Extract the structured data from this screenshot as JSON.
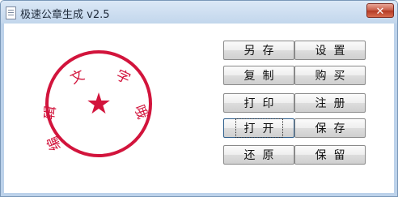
{
  "window": {
    "title": "极速公章生成 v2.5",
    "close_label": "✕"
  },
  "seal": {
    "arc_chars": [
      "编",
      "辑",
      "文",
      "字",
      "哦"
    ],
    "center_glyph": "★",
    "color": "#d2143c"
  },
  "buttons": {
    "saveas": "另存",
    "settings": "设置",
    "copy": "复制",
    "buy": "购买",
    "print": "打印",
    "register": "注册",
    "open": "打开",
    "save": "保存",
    "restore": "还原",
    "keep": "保留"
  }
}
